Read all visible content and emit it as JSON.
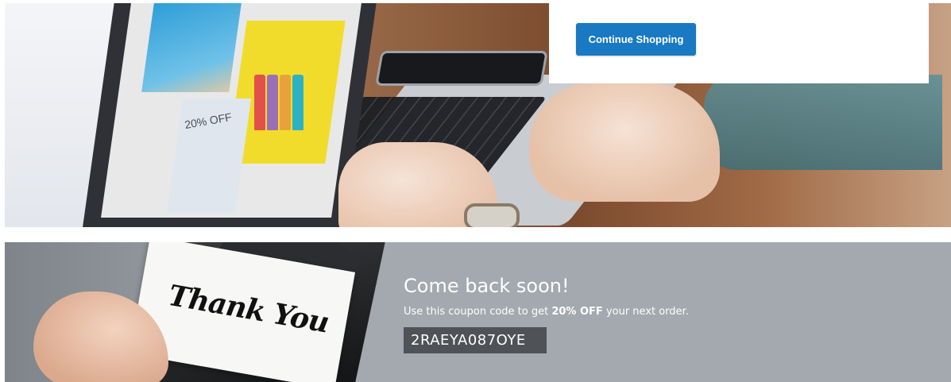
{
  "hero": {
    "continue_button_label": "Continue Shopping",
    "screen_promo_text": "20% OFF",
    "button_color": "#1979c3"
  },
  "coupon": {
    "title": "Come back soon!",
    "desc_before": "Use this coupon code to get ",
    "desc_bold": "20% OFF",
    "desc_after": " your next order.",
    "code": "2RAEYA087OYE",
    "card_text": "Thank You",
    "background_color": "#a3a9ae",
    "code_background_color": "#4f5256"
  }
}
